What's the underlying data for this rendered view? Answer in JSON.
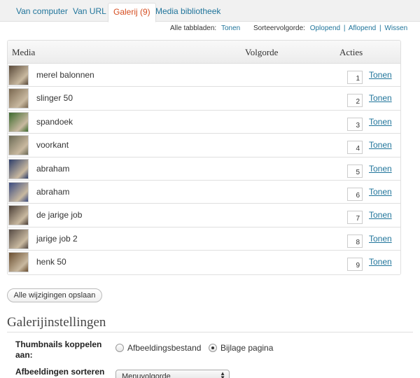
{
  "tabs": [
    {
      "label": "Van computer",
      "active": false
    },
    {
      "label": "Van URL",
      "active": false
    },
    {
      "label": "Galerij (9)",
      "active": true
    },
    {
      "label": "Media bibliotheek",
      "active": false
    }
  ],
  "subbar": {
    "all_tabs_label": "Alle tabbladen:",
    "all_tabs_link": "Tonen",
    "sort_label": "Sorteervolgorde:",
    "sort_asc": "Oplopend",
    "sort_desc": "Aflopend",
    "sort_clear": "Wissen",
    "separator": "|"
  },
  "table": {
    "headers": {
      "media": "Media",
      "order": "Volgorde",
      "actions": "Acties"
    },
    "show_label": "Tonen",
    "rows": [
      {
        "title": "merel balonnen",
        "order": "1",
        "thumb_color": "#5a4a3a"
      },
      {
        "title": "slinger 50",
        "order": "2",
        "thumb_color": "#7a6850"
      },
      {
        "title": "spandoek",
        "order": "3",
        "thumb_color": "#3d6a2e"
      },
      {
        "title": "voorkant",
        "order": "4",
        "thumb_color": "#6b6a55"
      },
      {
        "title": "abraham",
        "order": "5",
        "thumb_color": "#2e3e6a"
      },
      {
        "title": "abraham",
        "order": "6",
        "thumb_color": "#3a4a80"
      },
      {
        "title": "de jarige job",
        "order": "7",
        "thumb_color": "#4a3e36"
      },
      {
        "title": "jarige job 2",
        "order": "8",
        "thumb_color": "#554a44"
      },
      {
        "title": "henk 50",
        "order": "9",
        "thumb_color": "#6a4e30"
      }
    ]
  },
  "save_button": "Alle wijzigingen opslaan",
  "gallery_settings": {
    "heading": "Galerijinstellingen",
    "link_label_line1": "Thumbnails koppelen",
    "link_label_line2": "aan:",
    "option_file": "Afbeeldingsbestand",
    "option_attachment": "Bijlage pagina",
    "selected": "attachment",
    "sort_label": "Afbeeldingen sorteren",
    "sort_value": "Menuvolgorde"
  },
  "colors": {
    "link": "#21759b",
    "active_tab": "#d54e21"
  }
}
